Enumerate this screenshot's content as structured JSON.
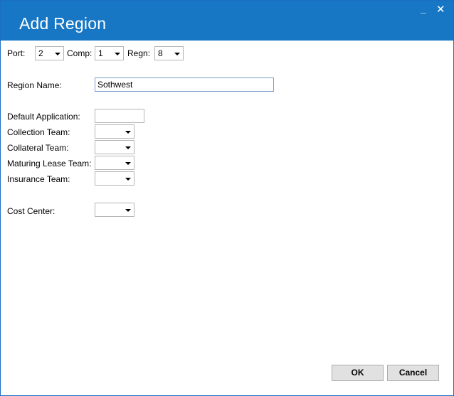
{
  "window": {
    "title": "Add Region"
  },
  "header": {
    "port_label": "Port:",
    "port_value": "2",
    "comp_label": "Comp:",
    "comp_value": "1",
    "regn_label": "Regn:",
    "regn_value": "8"
  },
  "form": {
    "region_name_label": "Region Name:",
    "region_name_value": "Sothwest",
    "default_application_label": "Default Application:",
    "default_application_value": "",
    "collection_team_label": "Collection Team:",
    "collection_team_value": "",
    "collateral_team_label": "Collateral Team:",
    "collateral_team_value": "",
    "maturing_lease_team_label": "Maturing Lease Team:",
    "maturing_lease_team_value": "",
    "insurance_team_label": "Insurance Team:",
    "insurance_team_value": "",
    "cost_center_label": "Cost Center:",
    "cost_center_value": ""
  },
  "buttons": {
    "ok": "OK",
    "cancel": "Cancel"
  },
  "icons": {
    "minimize": "minimize-icon",
    "close": "close-icon"
  },
  "colors": {
    "titlebar": "#1777c4"
  }
}
